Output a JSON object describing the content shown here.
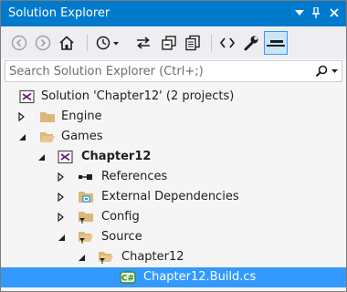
{
  "window": {
    "title": "Solution Explorer",
    "controls": [
      "dropdown-arrow-icon",
      "pin-icon",
      "close-icon"
    ]
  },
  "toolbar": {
    "buttons": [
      "back-icon",
      "forward-icon",
      "home-icon",
      "pending-changes-history-icon",
      "sync-with-active-document-icon",
      "collapse-all-icon",
      "show-all-files-icon",
      "view-code-icon",
      "properties-icon",
      "preview-selected-items-icon"
    ],
    "active": "preview-selected-items-icon"
  },
  "search": {
    "placeholder": "Search Solution Explorer (Ctrl+;)",
    "value": ""
  },
  "tree": {
    "solution": {
      "label": "Solution 'Chapter12' (2 projects)"
    },
    "engine": {
      "label": "Engine",
      "expanded": false
    },
    "games": {
      "label": "Games",
      "expanded": true
    },
    "chapter12_project": {
      "label": "Chapter12",
      "expanded": true
    },
    "references": {
      "label": "References",
      "expanded": false
    },
    "external_dependencies": {
      "label": "External Dependencies",
      "expanded": false
    },
    "config": {
      "label": "Config",
      "expanded": false
    },
    "source": {
      "label": "Source",
      "expanded": true
    },
    "chapter12_folder": {
      "label": "Chapter12",
      "expanded": true
    },
    "build_file": {
      "label": "Chapter12.Build.cs",
      "selected": true
    }
  },
  "colors": {
    "titlebar": "#007acc",
    "selection": "#3399ff",
    "folder": "#dcb67a",
    "vs_purple": "#68217a",
    "csharp_green": "#388a34"
  }
}
